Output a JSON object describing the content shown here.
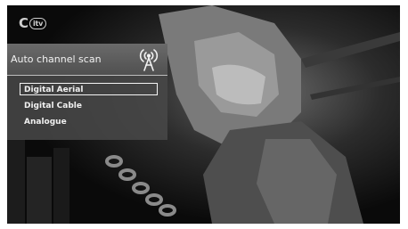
{
  "logo": {
    "letter": "C",
    "badge": "itv"
  },
  "menu": {
    "title": "Auto channel scan",
    "icon": "antenna-icon",
    "items": [
      {
        "label": "Digital Aerial",
        "selected": true
      },
      {
        "label": "Digital Cable",
        "selected": false
      },
      {
        "label": "Analogue",
        "selected": false
      }
    ]
  },
  "colors": {
    "menu_bg": "#484848",
    "text": "#f0f0f0",
    "highlight": "#f5f5f5"
  }
}
